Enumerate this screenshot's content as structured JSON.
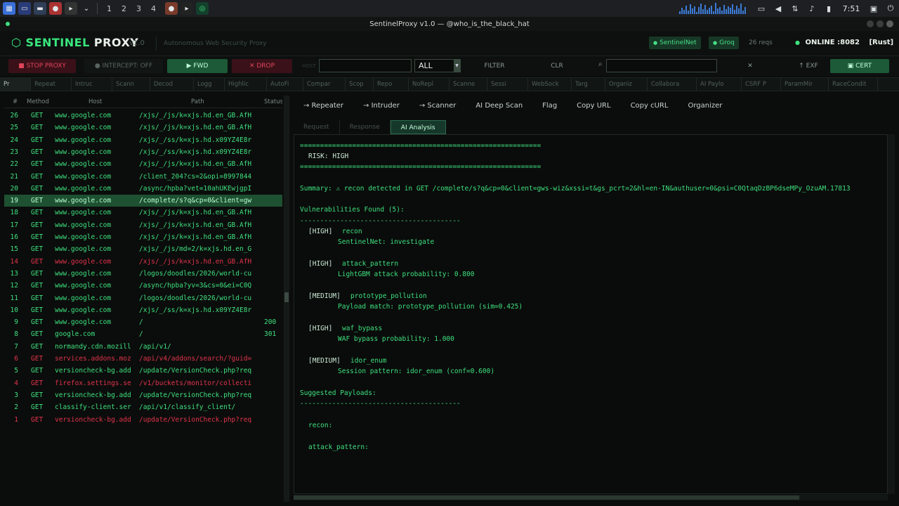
{
  "taskbar": {
    "workspaces": [
      "1",
      "2",
      "3",
      "4"
    ],
    "clock": "7:51"
  },
  "window": {
    "title": "SentinelProxy v1.0  —  @who_is_the_black_hat"
  },
  "header": {
    "logo_a": "SENTINEL",
    "logo_b": "PROXY",
    "version": "v1.0",
    "subtitle": "Autonomous Web Security Proxy",
    "pill_a": "SentinelNet",
    "pill_b": "Groq",
    "reqs": "26 reqs",
    "status": "ONLINE :8082",
    "engine": "[Rust]"
  },
  "toolbar": {
    "stop": "STOP PROXY",
    "intercept": "INTERCEPT: OFF",
    "fwd": "▶ FWD",
    "drop": "✕ DROP",
    "host_label": "HOST",
    "method_value": "ALL",
    "filter": "FILTER",
    "clr": "CLR",
    "search_glyph": "⌕",
    "close": "✕",
    "exf": "↑ EXF",
    "cert": "CERT"
  },
  "tools": [
    "Pr",
    "Repeat",
    "Intruc",
    "Scann",
    "Decod",
    "Logg",
    "Highlic",
    "AutoFi",
    "Compar",
    "Scop",
    "Repo",
    "NoRepl",
    "Scanne",
    "Sessi",
    "WebSock",
    "Targ",
    "Organiz",
    "Collabora",
    "AI Paylo",
    "CSRF P",
    "ParamMir",
    "RaceCondit"
  ],
  "table": {
    "headers": [
      "#",
      "Method",
      "Host",
      "Path",
      "Status"
    ],
    "rows": [
      {
        "n": "26",
        "m": "GET",
        "h": "www.google.com",
        "p": "/xjs/_/js/k=xjs.hd.en_GB.AfH",
        "s": "",
        "k": ""
      },
      {
        "n": "25",
        "m": "GET",
        "h": "www.google.com",
        "p": "/xjs/_/js/k=xjs.hd.en_GB.AfH",
        "s": "",
        "k": ""
      },
      {
        "n": "24",
        "m": "GET",
        "h": "www.google.com",
        "p": "/xjs/_/ss/k=xjs.hd.x09YZ4E8r",
        "s": "",
        "k": ""
      },
      {
        "n": "23",
        "m": "GET",
        "h": "www.google.com",
        "p": "/xjs/_/ss/k=xjs.hd.x09YZ4E8r",
        "s": "",
        "k": ""
      },
      {
        "n": "22",
        "m": "GET",
        "h": "www.google.com",
        "p": "/xjs/_/js/k=xjs.hd.en_GB.AfH",
        "s": "",
        "k": ""
      },
      {
        "n": "21",
        "m": "GET",
        "h": "www.google.com",
        "p": "/client_204?cs=2&opi=8997844",
        "s": "",
        "k": ""
      },
      {
        "n": "20",
        "m": "GET",
        "h": "www.google.com",
        "p": "/async/hpba?vet=10ahUKEwjgpI",
        "s": "",
        "k": ""
      },
      {
        "n": "19",
        "m": "GET",
        "h": "www.google.com",
        "p": "/complete/s?q&cp=0&client=gw",
        "s": "",
        "k": "sel"
      },
      {
        "n": "18",
        "m": "GET",
        "h": "www.google.com",
        "p": "/xjs/_/js/k=xjs.hd.en_GB.AfH",
        "s": "",
        "k": ""
      },
      {
        "n": "17",
        "m": "GET",
        "h": "www.google.com",
        "p": "/xjs/_/js/k=xjs.hd.en_GB.AfH",
        "s": "",
        "k": ""
      },
      {
        "n": "16",
        "m": "GET",
        "h": "www.google.com",
        "p": "/xjs/_/js/k=xjs.hd.en_GB.AfH",
        "s": "",
        "k": ""
      },
      {
        "n": "15",
        "m": "GET",
        "h": "www.google.com",
        "p": "/xjs/_/js/md=2/k=xjs.hd.en_G",
        "s": "",
        "k": ""
      },
      {
        "n": "14",
        "m": "GET",
        "h": "www.google.com",
        "p": "/xjs/_/js/k=xjs.hd.en_GB.AfH",
        "s": "",
        "k": "err"
      },
      {
        "n": "13",
        "m": "GET",
        "h": "www.google.com",
        "p": "/logos/doodles/2026/world-cu",
        "s": "",
        "k": ""
      },
      {
        "n": "12",
        "m": "GET",
        "h": "www.google.com",
        "p": "/async/hpba?yv=3&cs=0&ei=C0Q",
        "s": "",
        "k": ""
      },
      {
        "n": "11",
        "m": "GET",
        "h": "www.google.com",
        "p": "/logos/doodles/2026/world-cu",
        "s": "",
        "k": ""
      },
      {
        "n": "10",
        "m": "GET",
        "h": "www.google.com",
        "p": "/xjs/_/ss/k=xjs.hd.x09YZ4E8r",
        "s": "",
        "k": ""
      },
      {
        "n": "9",
        "m": "GET",
        "h": "www.google.com",
        "p": "/",
        "s": "200",
        "k": ""
      },
      {
        "n": "8",
        "m": "GET",
        "h": "google.com",
        "p": "/",
        "s": "301",
        "k": ""
      },
      {
        "n": "7",
        "m": "GET",
        "h": "normandy.cdn.mozill",
        "p": "/api/v1/",
        "s": "",
        "k": ""
      },
      {
        "n": "6",
        "m": "GET",
        "h": "services.addons.moz",
        "p": "/api/v4/addons/search/?guid=",
        "s": "",
        "k": "err"
      },
      {
        "n": "5",
        "m": "GET",
        "h": "versioncheck-bg.add",
        "p": "/update/VersionCheck.php?req",
        "s": "",
        "k": ""
      },
      {
        "n": "4",
        "m": "GET",
        "h": "firefox.settings.se",
        "p": "/v1/buckets/monitor/collecti",
        "s": "",
        "k": "err"
      },
      {
        "n": "3",
        "m": "GET",
        "h": "versioncheck-bg.add",
        "p": "/update/VersionCheck.php?req",
        "s": "",
        "k": ""
      },
      {
        "n": "2",
        "m": "GET",
        "h": "classify-client.ser",
        "p": "/api/v1/classify_client/",
        "s": "",
        "k": ""
      },
      {
        "n": "1",
        "m": "GET",
        "h": "versioncheck-bg.add",
        "p": "/update/VersionCheck.php?req",
        "s": "",
        "k": "err"
      }
    ]
  },
  "actions": [
    "→ Repeater",
    "→ Intruder",
    "→ Scanner",
    "AI Deep Scan",
    "Flag",
    "Copy URL",
    "Copy cURL",
    "Organizer"
  ],
  "subtabs": [
    "Request",
    "Response",
    "AI Analysis"
  ],
  "analysis": {
    "rule": "============================================================",
    "risk": "RISK: HIGH",
    "summary": "Summary: ⚠ recon detected in GET /complete/s?q&cp=0&client=gws-wiz&xssi=t&gs_pcrt=2&hl=en-IN&authuser=0&psi=C0QtaqDzBP6dseMPy_OzuAM.17813",
    "vuln_head": "Vulnerabilities Found (5):",
    "dash": "----------------------------------------",
    "vulns": [
      {
        "sev": "[HIGH]",
        "name": "recon",
        "detail": "SentinelNet: investigate"
      },
      {
        "sev": "[HIGH]",
        "name": "attack_pattern",
        "detail": "LightGBM attack probability: 0.800"
      },
      {
        "sev": "[MEDIUM]",
        "name": "prototype_pollution",
        "detail": "Payload match: prototype_pollution (sim=0.425)"
      },
      {
        "sev": "[HIGH]",
        "name": "waf_bypass",
        "detail": "WAF bypass probability: 1.000"
      },
      {
        "sev": "[MEDIUM]",
        "name": "idor_enum",
        "detail": "Session pattern: idor_enum (conf=0.600)"
      }
    ],
    "payload_head": "Suggested Payloads:",
    "payloads": [
      "recon:",
      "attack_pattern:"
    ]
  },
  "colors": {
    "accent": "#3ee07e",
    "danger": "#e1334b",
    "selected": "#1e5131"
  }
}
